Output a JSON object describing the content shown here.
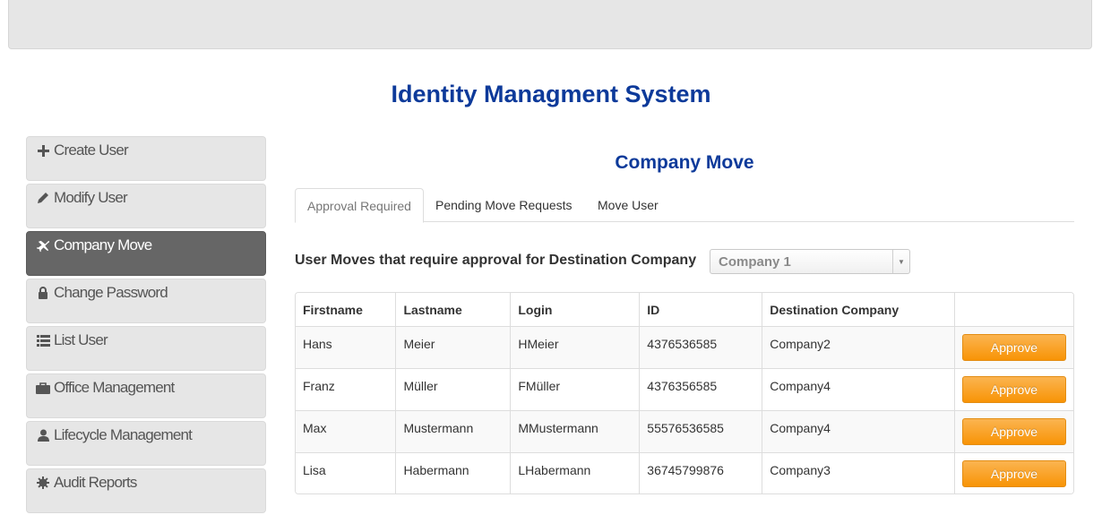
{
  "app": {
    "title": "Identity Managment System"
  },
  "colors": {
    "title": "#0d3a9a",
    "approve": "#f89406",
    "active_nav": "#666666"
  },
  "sidebar": {
    "items": [
      {
        "label": "Create User",
        "icon": "plus-icon"
      },
      {
        "label": "Modify User",
        "icon": "pencil-icon"
      },
      {
        "label": "Company Move",
        "icon": "plane-icon",
        "active": true
      },
      {
        "label": "Change Password",
        "icon": "lock-icon"
      },
      {
        "label": "List User",
        "icon": "list-icon"
      },
      {
        "label": "Office Management",
        "icon": "briefcase-icon"
      },
      {
        "label": "Lifecycle Management",
        "icon": "user-icon"
      },
      {
        "label": "Audit Reports",
        "icon": "gear-icon"
      }
    ]
  },
  "main": {
    "section_title": "Company Move",
    "tabs": [
      {
        "label": "Approval Required",
        "active": true
      },
      {
        "label": "Pending Move Requests"
      },
      {
        "label": "Move User"
      }
    ],
    "filter": {
      "label": "User Moves that require approval for Destination Company",
      "selected": "Company 1"
    },
    "table": {
      "columns": [
        "Firstname",
        "Lastname",
        "Login",
        "ID",
        "Destination Company",
        ""
      ],
      "rows": [
        {
          "firstname": "Hans",
          "lastname": "Meier",
          "login": "HMeier",
          "id": "4376536585",
          "destination": "Company2",
          "action": "Approve"
        },
        {
          "firstname": "Franz",
          "lastname": "Müller",
          "login": "FMüller",
          "id": "4376356585",
          "destination": "Company4",
          "action": "Approve"
        },
        {
          "firstname": "Max",
          "lastname": "Mustermann",
          "login": "MMustermann",
          "id": "55576536585",
          "destination": "Company4",
          "action": "Approve"
        },
        {
          "firstname": "Lisa",
          "lastname": "Habermann",
          "login": "LHabermann",
          "id": "36745799876",
          "destination": "Company3",
          "action": "Approve"
        }
      ]
    }
  }
}
